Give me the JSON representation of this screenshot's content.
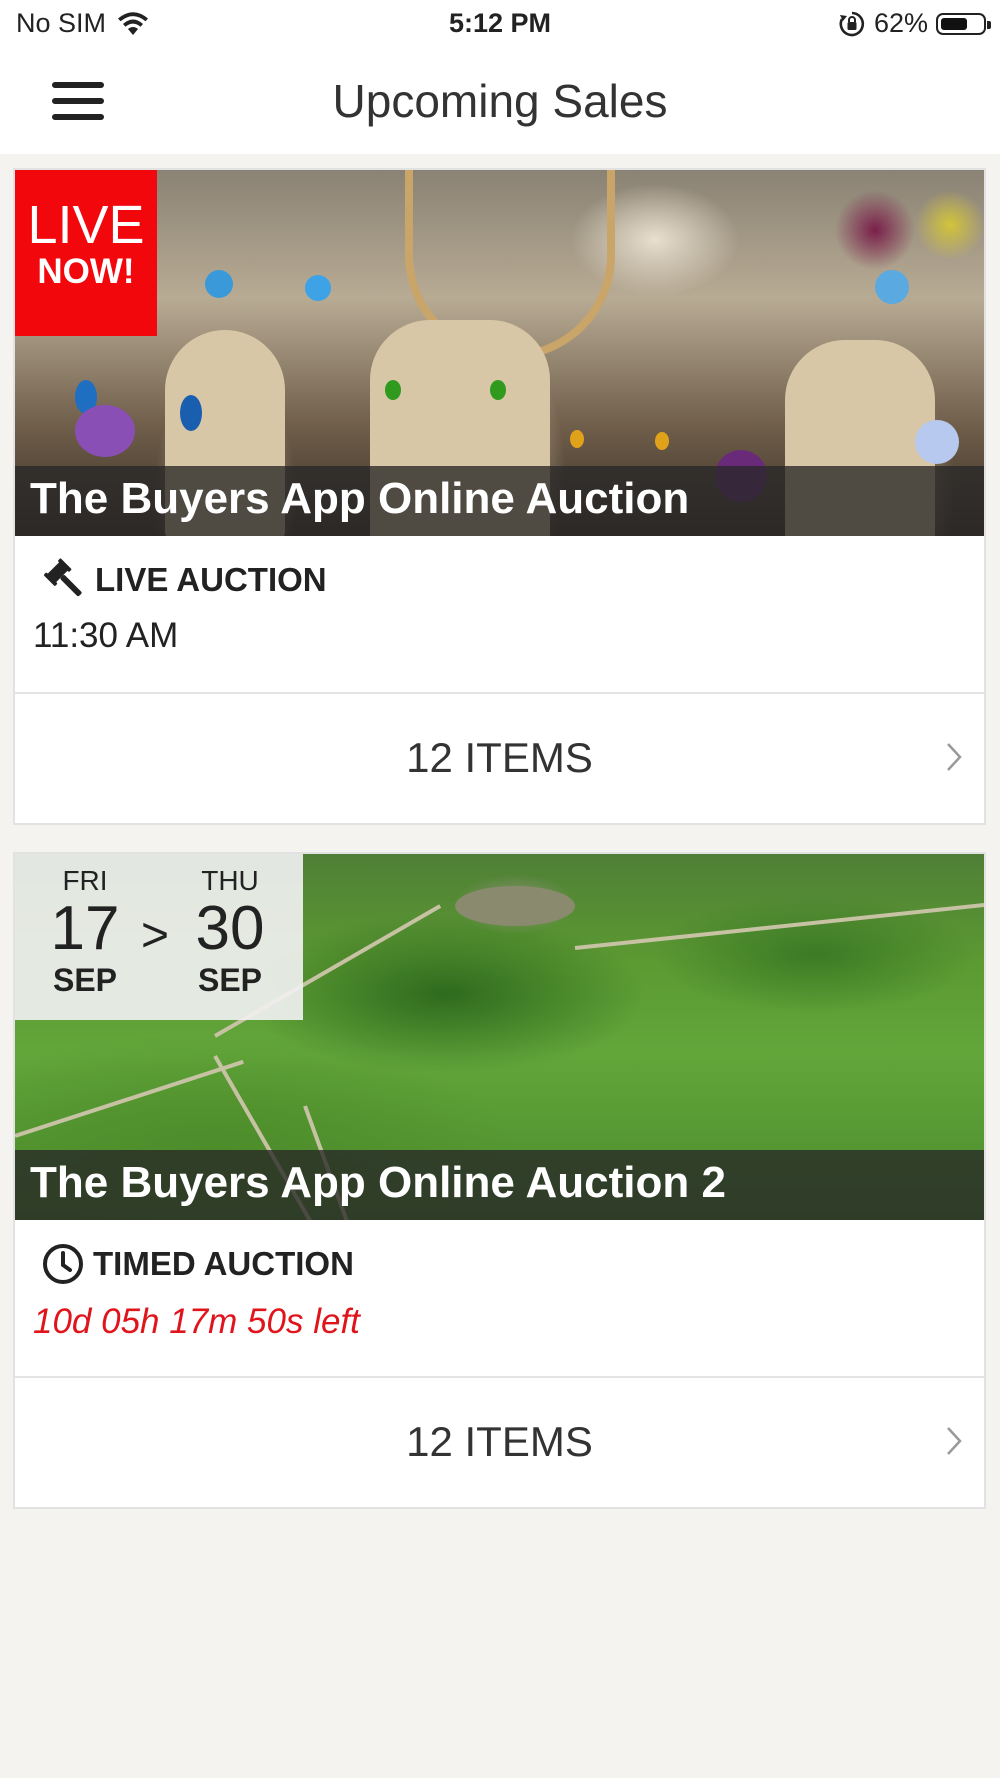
{
  "status_bar": {
    "carrier": "No SIM",
    "time": "5:12 PM",
    "battery": "62%"
  },
  "header": {
    "title": "Upcoming Sales"
  },
  "sales": [
    {
      "title": "The Buyers App Online Auction",
      "badge_line1": "LIVE",
      "badge_line2": "NOW!",
      "type_label": "LIVE AUCTION",
      "time": "11:30 AM",
      "items_label": "12 ITEMS"
    },
    {
      "title": "The Buyers App Online Auction 2",
      "start": {
        "dow": "FRI",
        "day": "17",
        "month": "SEP"
      },
      "arrow": ">",
      "end": {
        "dow": "THU",
        "day": "30",
        "month": "SEP"
      },
      "type_label": "TIMED AUCTION",
      "time_left": "10d 05h 17m 50s left",
      "items_label": "12 ITEMS"
    }
  ],
  "colors": {
    "live_red": "#f2070d",
    "countdown_red": "#e0141b",
    "background": "#f4f3f0"
  },
  "icons": {
    "menu": "hamburger-icon",
    "wifi": "wifi-icon",
    "orientation_lock": "rotation-lock-icon",
    "battery": "battery-icon",
    "live_auction": "gavel-icon",
    "timed_auction": "clock-icon",
    "chevron": "chevron-right-icon"
  }
}
